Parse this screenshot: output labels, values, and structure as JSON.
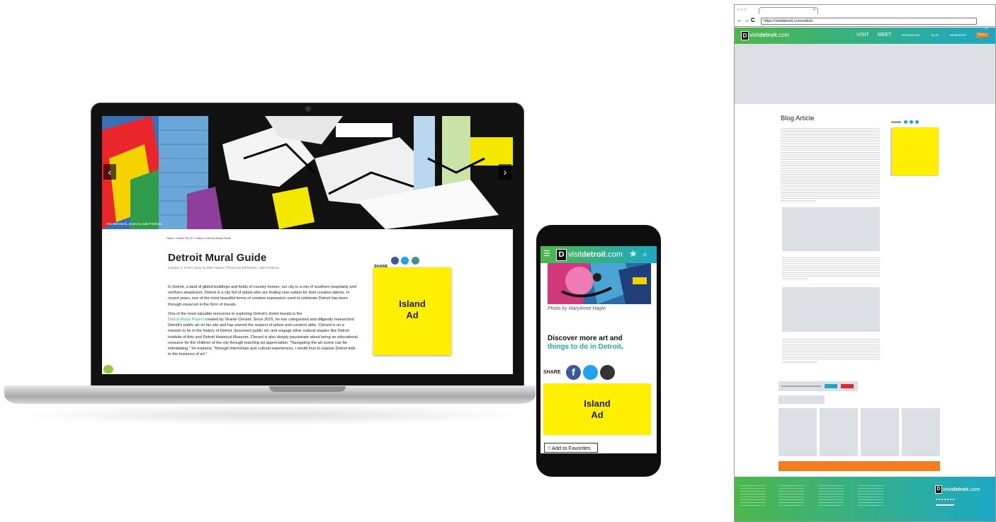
{
  "laptop": {
    "hero_caption": "The Belt Mural, photo by Julie Fiedman",
    "breadcrumb": "Home / Inside The D / Culture / Detroit Mural Guide",
    "title": "Detroit Mural Guide",
    "meta": "October 4, 2018  |  Story by Bike Adams  |  Photos by Bill Bowen, Julie Fiedman",
    "p1": "In Detroit, a land of gilded buildings and fields of country homes; our city is a mix of southern hospitality and northern skepticism. Detroit is a city full of artists who are finding new outlets for their creative talents.  In recent years, one of the most beautiful forms of creative expression used to celebrate Detroit has been through visual art in the form of murals.",
    "p2_pre": "One of the most valuable resources to exploring Detroit's street murals is the",
    "p2_link": "Detroit Mural Project",
    "p2_post": " created by Viranel Clerard.  Since 2015, he has categorized and diligently researched Detroit's public art on his site and has earned the respect of artists and curators alike. Clerard is on a mission to tie in the history of Detroit, document public art, and engage other cultural staples like Detroit Institute of Arts and Detroit Historical Museum. Clerard is also deeply passionate about being an educational resource for the children of the city through teaching art appreciation. \"Navigating the art scene can be intimidating,\" he explains, \"through internships and cultural experiences, I would love to expose Detroit kids to the business of art.\"",
    "share_label": "SHARE",
    "island_line1": "Island",
    "island_line2": "Ad"
  },
  "phone": {
    "logo_light": "visit",
    "logo_bold": "detroit",
    "logo_suffix": ".com",
    "photo_caption": "Photo by MaryAnne Hagle.",
    "discover_line1": "Discover more art and",
    "discover_line2": "things to do in Detroit",
    "discover_period": ".",
    "share_label": "SHARE",
    "island_line1": "Island",
    "island_line2": "Ad",
    "favorites_label": "Add to Favorites"
  },
  "wireframe": {
    "url": "https://visitdetroit.com/article",
    "nav_visit": "VISIT",
    "nav_meet": "MEET",
    "nav_destinations": "DESTINATIONS",
    "nav_blog": "BLOG",
    "nav_membership": "MEMBERSHIP",
    "nav_cta": "DEALS",
    "logo_light": "visit",
    "logo_bold": "detroit",
    "logo_suffix": ".com",
    "article_heading": "Blog Article",
    "share_label": "SHARE"
  },
  "colors": {
    "teal": "#1ba8c6",
    "green": "#4cb848",
    "island_yellow": "#ffef00",
    "orange": "#f47d20",
    "red": "#e8262b"
  }
}
